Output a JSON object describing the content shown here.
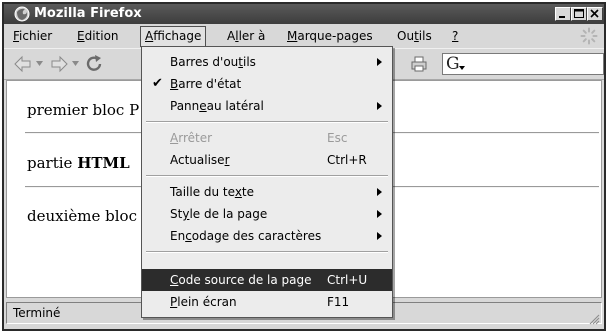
{
  "window": {
    "title": "Mozilla Firefox",
    "minimize": "_",
    "maximize": "□",
    "close": "×"
  },
  "menubar": {
    "fichier": "Fichier",
    "edition": "Edition",
    "affichage": "Affichage",
    "aller": "Aller à",
    "marque_pages": "Marque-pages",
    "outils": "Outils",
    "aide": "?"
  },
  "toolbar": {
    "google_label": "G",
    "icons": [
      "back-arrow-icon",
      "forward-arrow-icon",
      "reload-icon",
      "print-icon",
      "search-engine-icon"
    ]
  },
  "content": {
    "p1": "premier bloc P",
    "p2_prefix": "partie ",
    "p2_bold": "HTML",
    "p3": "deuxième bloc"
  },
  "dropdown": {
    "barres_outils": "Barres d'outils",
    "barre_etat": "Barre d'état",
    "panneau_lateral": "Panneau latéral",
    "arreter": "Arrêter",
    "arreter_acc": "Esc",
    "actualiser": "Actualiser",
    "actualiser_acc": "Ctrl+R",
    "taille_texte": "Taille du texte",
    "style_page": "Style de la page",
    "encodage": "Encodage des caractères",
    "code_source": "Code source de la page",
    "code_source_acc": "Ctrl+U",
    "plein_ecran": "Plein écran",
    "plein_ecran_acc": "F11",
    "checkmark": "✔"
  },
  "status": {
    "text": "Terminé"
  }
}
